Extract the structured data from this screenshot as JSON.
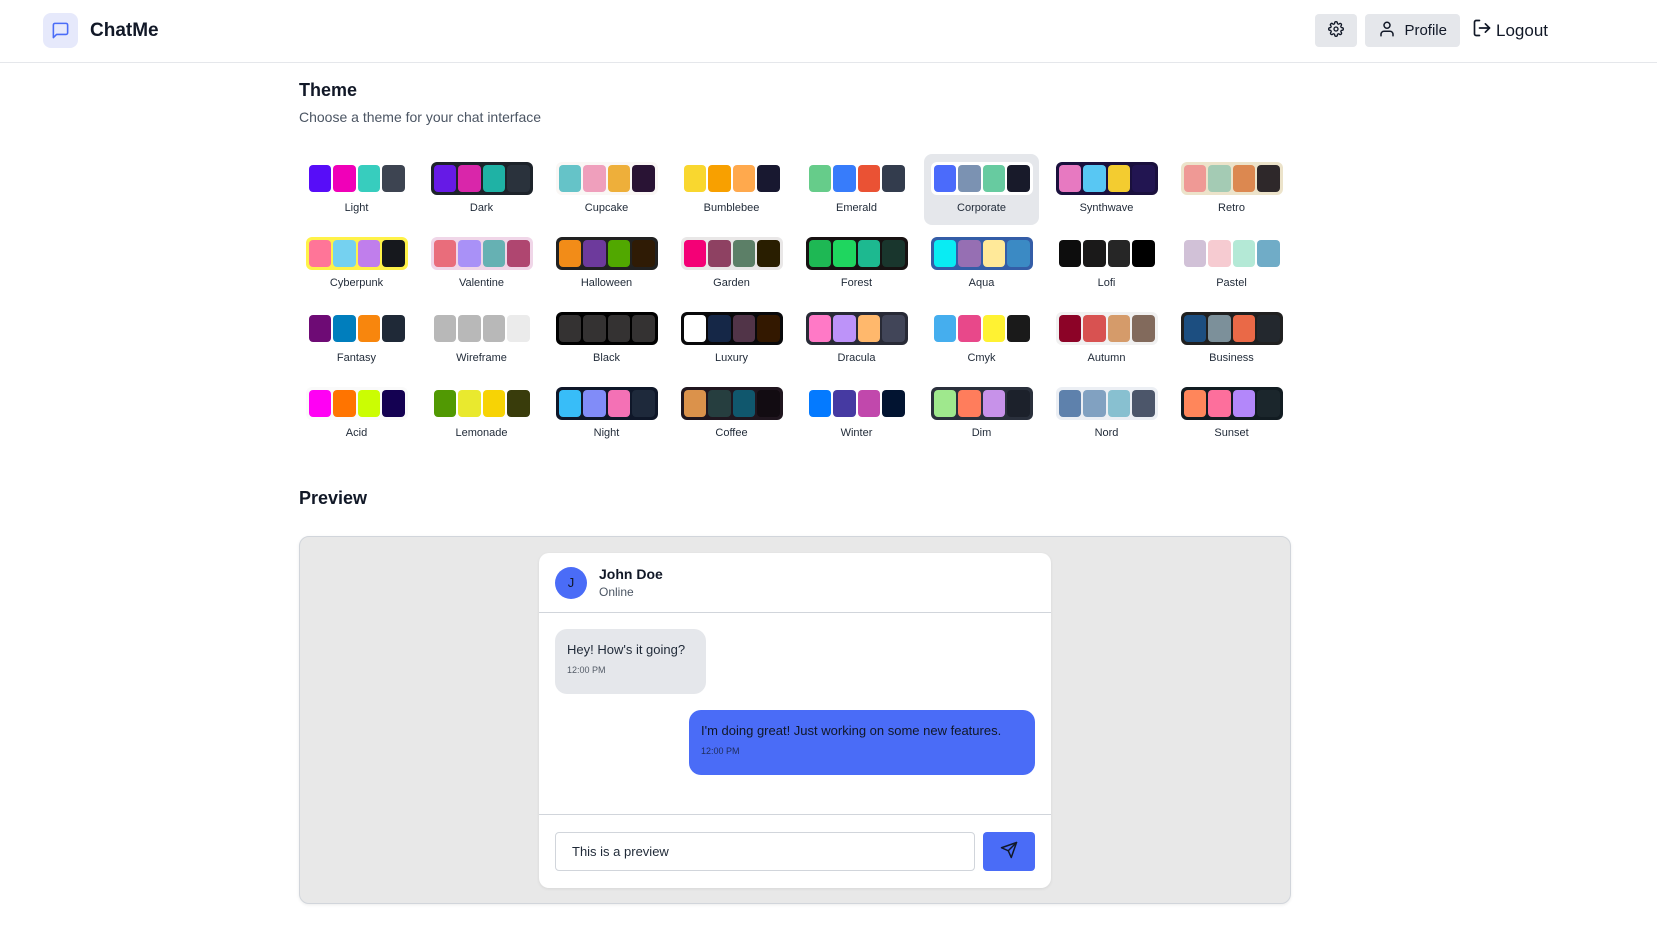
{
  "app": {
    "name": "ChatMe",
    "logo_icon": "message-square-icon"
  },
  "nav": {
    "settings_icon": "gear-icon",
    "profile_label": "Profile",
    "logout_label": "Logout"
  },
  "theme_section": {
    "title": "Theme",
    "subtitle": "Choose a theme for your chat interface",
    "selected": "Corporate"
  },
  "themes": [
    {
      "name": "Light",
      "frame": "#ffffff",
      "colors": [
        "#570df8",
        "#f000b8",
        "#37cdbe",
        "#3d4451"
      ]
    },
    {
      "name": "Dark",
      "frame": "#1d232a",
      "colors": [
        "#661ae6",
        "#d926aa",
        "#1fb2a5",
        "#2a323c"
      ]
    },
    {
      "name": "Cupcake",
      "frame": "#faf7f5",
      "colors": [
        "#65c3c8",
        "#ef9fbc",
        "#eeaf3a",
        "#291334"
      ]
    },
    {
      "name": "Bumblebee",
      "frame": "#ffffff",
      "colors": [
        "#f9d72f",
        "#f8a000",
        "#ffa94d",
        "#181830"
      ]
    },
    {
      "name": "Emerald",
      "frame": "#ffffff",
      "colors": [
        "#66cc8a",
        "#377cfb",
        "#ea5234",
        "#333c4d"
      ]
    },
    {
      "name": "Corporate",
      "frame": "#ffffff",
      "colors": [
        "#4b6bfb",
        "#7b92b2",
        "#67cba0",
        "#181a2a"
      ]
    },
    {
      "name": "Synthwave",
      "frame": "#1a103d",
      "colors": [
        "#e779c1",
        "#58c7f3",
        "#f3cc30",
        "#221551"
      ]
    },
    {
      "name": "Retro",
      "frame": "#ece3ca",
      "colors": [
        "#ef9995",
        "#a4cbb4",
        "#dc8850",
        "#2e282a"
      ]
    },
    {
      "name": "Cyberpunk",
      "frame": "#fff248",
      "colors": [
        "#ff7598",
        "#75d1f0",
        "#c07eec",
        "#16181d"
      ]
    },
    {
      "name": "Valentine",
      "frame": "#f0d6e8",
      "colors": [
        "#e96d7b",
        "#a991f7",
        "#66b1b3",
        "#af4670"
      ]
    },
    {
      "name": "Halloween",
      "frame": "#212121",
      "colors": [
        "#f28c18",
        "#6d3a9c",
        "#51a800",
        "#2f1b05"
      ]
    },
    {
      "name": "Garden",
      "frame": "#e9e7e7",
      "colors": [
        "#f40076",
        "#8e4162",
        "#5c7f67",
        "#291e00"
      ]
    },
    {
      "name": "Forest",
      "frame": "#171212",
      "colors": [
        "#1eb854",
        "#1fd65f",
        "#1db990",
        "#19362d"
      ]
    },
    {
      "name": "Aqua",
      "frame": "#345da7",
      "colors": [
        "#09ecf3",
        "#966fb3",
        "#ffe999",
        "#3b8ac4"
      ]
    },
    {
      "name": "Lofi",
      "frame": "#ffffff",
      "colors": [
        "#0d0d0d",
        "#1a1919",
        "#262626",
        "#000000"
      ]
    },
    {
      "name": "Pastel",
      "frame": "#ffffff",
      "colors": [
        "#d1c1d7",
        "#f6cbd1",
        "#b4e9d6",
        "#70acc7"
      ]
    },
    {
      "name": "Fantasy",
      "frame": "#ffffff",
      "colors": [
        "#6e0b75",
        "#007ebd",
        "#f8860d",
        "#1f2937"
      ]
    },
    {
      "name": "Wireframe",
      "frame": "#ffffff",
      "colors": [
        "#b8b8b8",
        "#b8b8b8",
        "#b8b8b8",
        "#ebebeb"
      ]
    },
    {
      "name": "Black",
      "frame": "#000000",
      "colors": [
        "#343232",
        "#343232",
        "#343232",
        "#343232"
      ]
    },
    {
      "name": "Luxury",
      "frame": "#09090b",
      "colors": [
        "#ffffff",
        "#152747",
        "#513448",
        "#331800"
      ]
    },
    {
      "name": "Dracula",
      "frame": "#282a36",
      "colors": [
        "#ff79c6",
        "#bd93f9",
        "#ffb86c",
        "#414558"
      ]
    },
    {
      "name": "Cmyk",
      "frame": "#ffffff",
      "colors": [
        "#45aeee",
        "#e8488a",
        "#fff232",
        "#1a1a1a"
      ]
    },
    {
      "name": "Autumn",
      "frame": "#f1f1f1",
      "colors": [
        "#8c0327",
        "#d85251",
        "#d59b6a",
        "#826a5c"
      ]
    },
    {
      "name": "Business",
      "frame": "#202020",
      "colors": [
        "#1c4e80",
        "#7c909a",
        "#ea6947",
        "#23282e"
      ]
    },
    {
      "name": "Acid",
      "frame": "#fafafa",
      "colors": [
        "#ff00f4",
        "#ff7400",
        "#cbfd03",
        "#140152"
      ]
    },
    {
      "name": "Lemonade",
      "frame": "#ffffff",
      "colors": [
        "#519903",
        "#e9e92e",
        "#f7d305",
        "#393c0b"
      ]
    },
    {
      "name": "Night",
      "frame": "#0f1729",
      "colors": [
        "#38bdf8",
        "#818cf8",
        "#f471b5",
        "#1e293b"
      ]
    },
    {
      "name": "Coffee",
      "frame": "#20161f",
      "colors": [
        "#db924b",
        "#263e3f",
        "#10576d",
        "#120c12"
      ]
    },
    {
      "name": "Winter",
      "frame": "#ffffff",
      "colors": [
        "#047aff",
        "#463aa2",
        "#c148ac",
        "#021431"
      ]
    },
    {
      "name": "Dim",
      "frame": "#2a303c",
      "colors": [
        "#9fe88d",
        "#ff7d5c",
        "#c792e9",
        "#1c212b"
      ]
    },
    {
      "name": "Nord",
      "frame": "#eceff4",
      "colors": [
        "#5e81ac",
        "#81a1c1",
        "#88c0d0",
        "#4c566a"
      ]
    },
    {
      "name": "Sunset",
      "frame": "#121c22",
      "colors": [
        "#ff865b",
        "#fd6f9c",
        "#b387fa",
        "#1b262c"
      ]
    }
  ],
  "preview": {
    "title": "Preview",
    "contact": {
      "initial": "J",
      "name": "John Doe",
      "status": "Online"
    },
    "messages": [
      {
        "text": "Hey! How's it going?",
        "time": "12:00 PM",
        "own": false
      },
      {
        "text": "I'm doing great! Just working on some new features.",
        "time": "12:00 PM",
        "own": true
      }
    ],
    "input_value": "This is a preview",
    "send_icon": "send-icon",
    "primary_color": "#4a6cf7"
  }
}
